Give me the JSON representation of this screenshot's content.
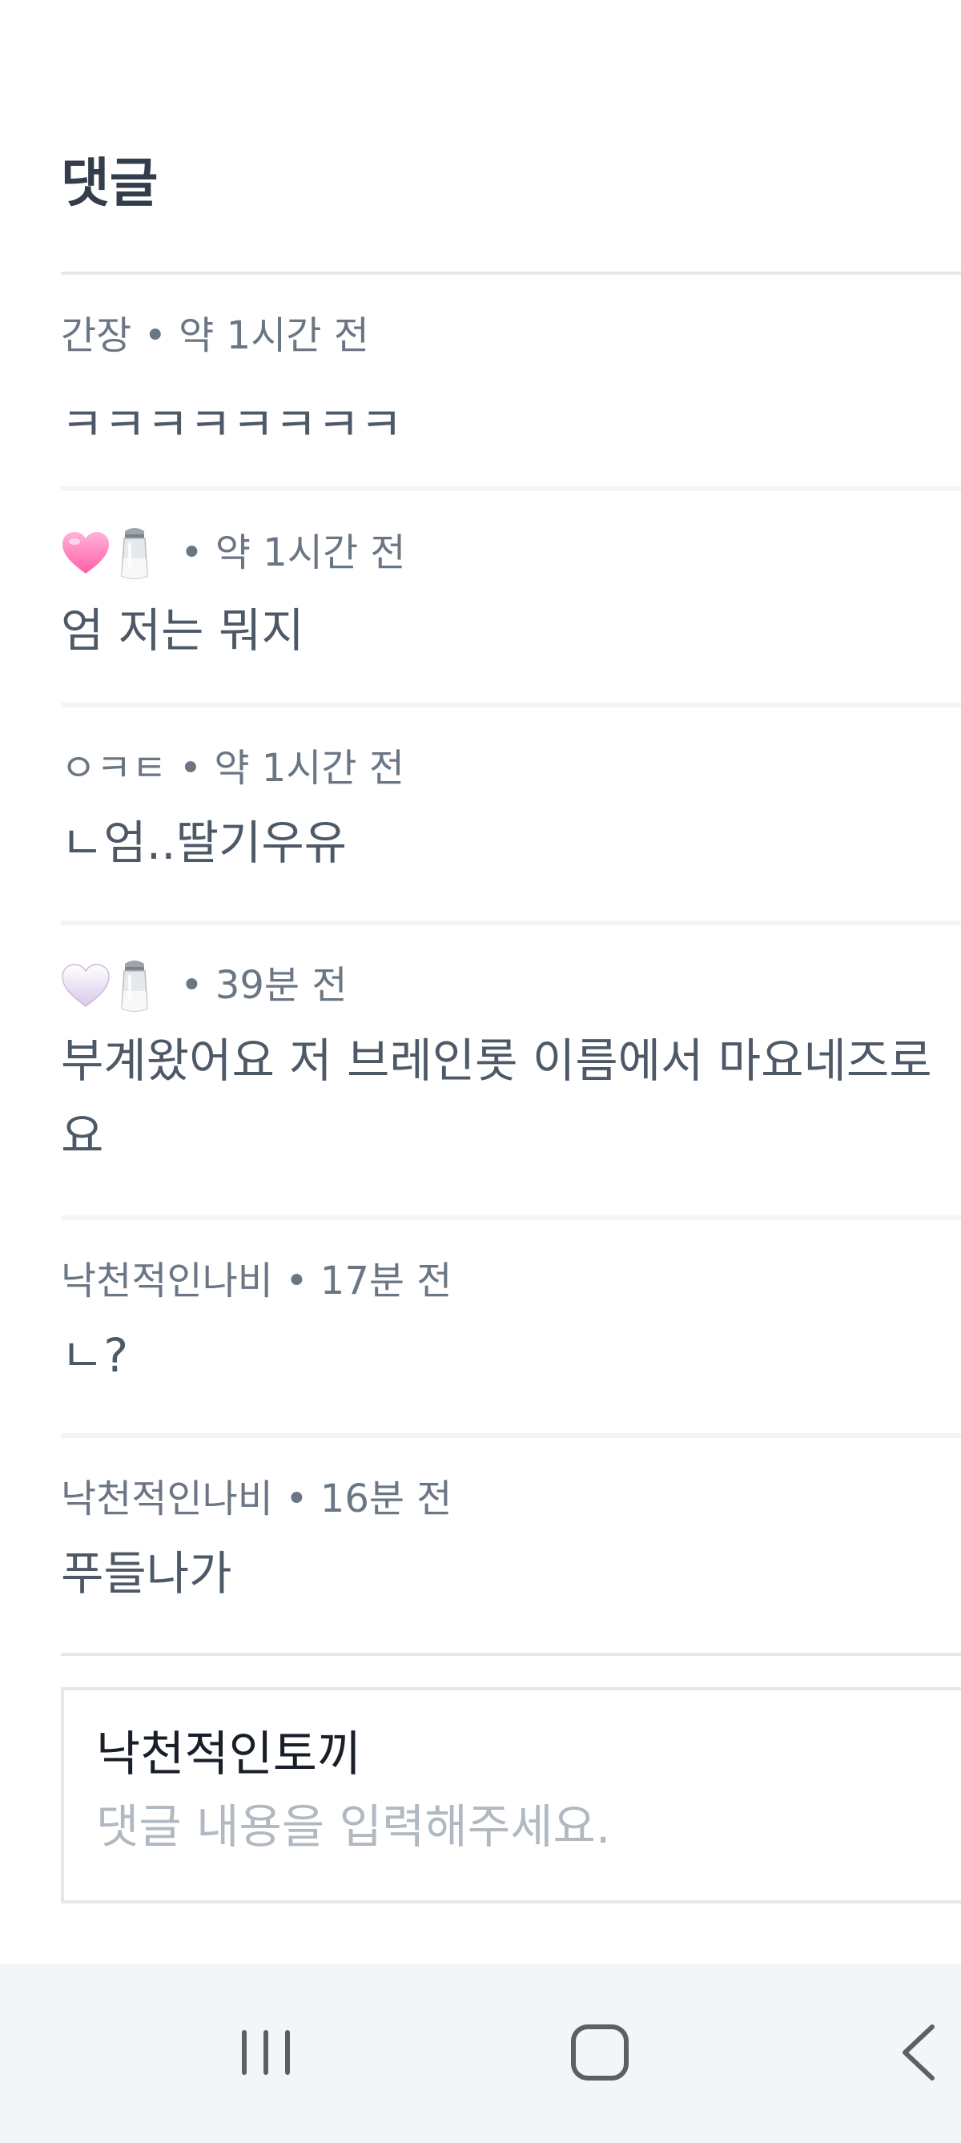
{
  "section": {
    "title": "댓글"
  },
  "comments": [
    {
      "author": "간장",
      "separator": " • ",
      "time": "약 1시간 전",
      "body": "ㅋㅋㅋㅋㅋㅋㅋㅋ"
    },
    {
      "author_icons": [
        "pink-heart-icon",
        "salt-shaker-icon"
      ],
      "separator": " • ",
      "time": "약 1시간 전",
      "body": "엄 저는 뭐지"
    },
    {
      "author": "ㅇㅋㅌ",
      "separator": " • ",
      "time": "약 1시간 전",
      "body": "ㄴ엄..딸기우유"
    },
    {
      "author_icons": [
        "white-heart-icon",
        "salt-shaker-icon"
      ],
      "separator": " • ",
      "time": "39분 전",
      "body_lines": [
        "부계왔어요 저 브레인롯 이름에서 마요네즈로",
        "요"
      ]
    },
    {
      "author": "낙천적인나비",
      "separator": " • ",
      "time": "17분 전",
      "body": "ㄴ?"
    },
    {
      "author": "낙천적인나비",
      "separator": " • ",
      "time": "16분 전",
      "body": "푸들나가"
    }
  ],
  "comment_input": {
    "username": "낙천적인토끼",
    "placeholder": "댓글 내용을 입력해주세요.",
    "value": ""
  },
  "nav_bar": {
    "buttons": [
      "recent-apps-icon",
      "home-icon",
      "back-icon"
    ]
  },
  "colors": {
    "title": "#333d4b",
    "meta": "#6b7684",
    "body": "#4e5968",
    "divider": "#e5e8eb",
    "placeholder": "#b0b8c1",
    "nav_bg": "#f4f5f7"
  }
}
